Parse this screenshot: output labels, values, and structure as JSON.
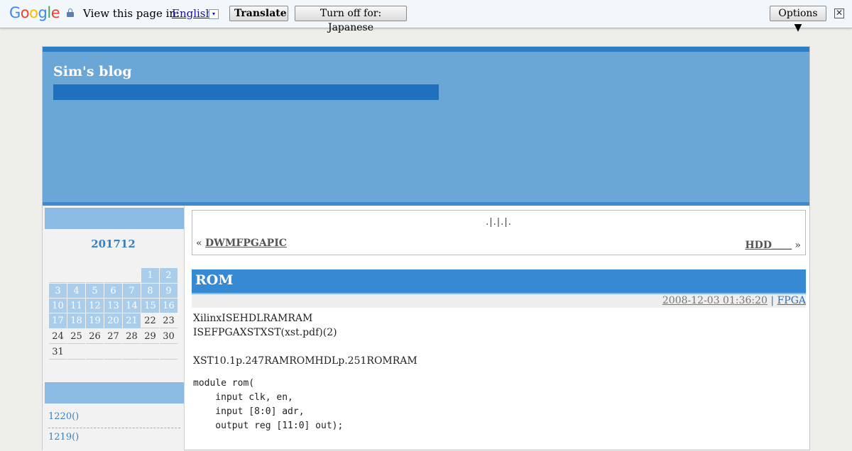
{
  "translate_bar": {
    "logo": [
      "G",
      "o",
      "o",
      "g",
      "l",
      "e"
    ],
    "view_text": "View this page in:",
    "language": "English",
    "language_arrow": "▾",
    "translate_label": "Translate",
    "turn_off_label": "Turn off for: Japanese",
    "options_label": "Options ▼",
    "close_label": "✕"
  },
  "blog": {
    "title": "Sim's blog"
  },
  "calendar": {
    "title": "201712",
    "rows": [
      [
        "",
        "",
        "",
        "",
        "",
        "1",
        "2"
      ],
      [
        "3",
        "4",
        "5",
        "6",
        "7",
        "8",
        "9"
      ],
      [
        "10",
        "11",
        "12",
        "13",
        "14",
        "15",
        "16"
      ],
      [
        "17",
        "18",
        "19",
        "20",
        "21",
        "22",
        "23"
      ],
      [
        "24",
        "25",
        "26",
        "27",
        "28",
        "29",
        "30"
      ],
      [
        "31",
        "",
        "",
        "",
        "",
        "",
        ""
      ]
    ]
  },
  "archive": {
    "items": [
      "1220()",
      "1219()"
    ]
  },
  "nav": {
    "dots": ".|.|.|.",
    "prev_symbol": "«",
    "prev_label": "DWMFPGAPIC",
    "next_label": "HDD＿＿",
    "next_symbol": "»"
  },
  "entry": {
    "title": "ROM",
    "date": "2008-12-03 01:36:20",
    "separator": "|",
    "category": "FPGA",
    "para1": "XilinxISEHDLRAMRAM",
    "para2": "ISEFPGAXSTXST(xst.pdf)(2)",
    "para3": "XST10.1p.247RAMROMHDLp.251ROMRAM",
    "code": "module rom(\n    input clk, en,\n    input [8:0] adr,\n    output reg [11:0] out);"
  }
}
